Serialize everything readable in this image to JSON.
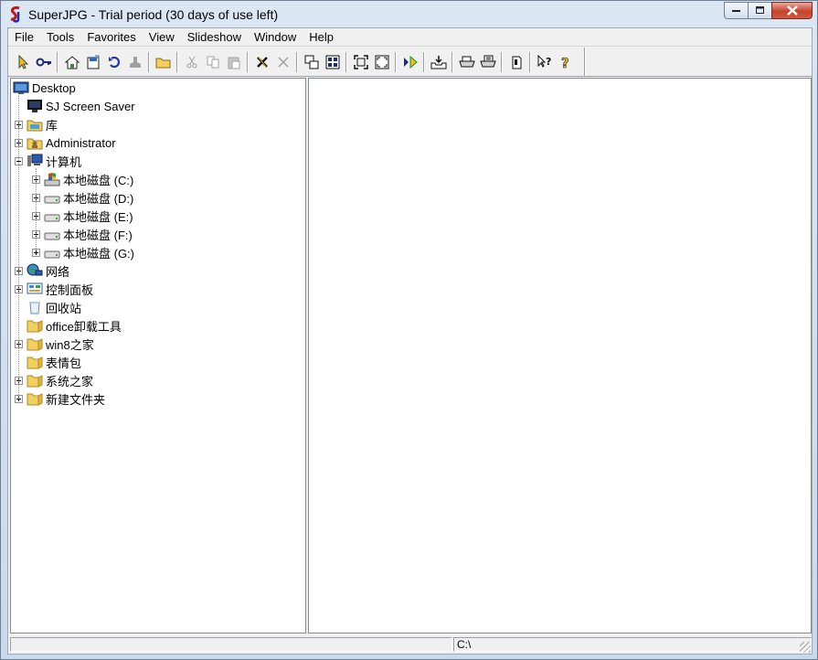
{
  "window": {
    "title": "SuperJPG - Trial period (30 days of use left)"
  },
  "menu": [
    "File",
    "Tools",
    "Favorites",
    "View",
    "Slideshow",
    "Window",
    "Help"
  ],
  "tree": {
    "root": "Desktop",
    "items": [
      {
        "label": "SJ Screen Saver",
        "level": 1,
        "expander": "none",
        "icon": "monitor-icon"
      },
      {
        "label": "库",
        "level": 1,
        "expander": "plus",
        "icon": "library-icon"
      },
      {
        "label": "Administrator",
        "level": 1,
        "expander": "plus",
        "icon": "user-folder-icon"
      },
      {
        "label": "计算机",
        "level": 1,
        "expander": "minus",
        "icon": "computer-icon"
      },
      {
        "label": "本地磁盘 (C:)",
        "level": 2,
        "expander": "plus",
        "icon": "system-drive-icon"
      },
      {
        "label": "本地磁盘 (D:)",
        "level": 2,
        "expander": "plus",
        "icon": "drive-icon"
      },
      {
        "label": "本地磁盘 (E:)",
        "level": 2,
        "expander": "plus",
        "icon": "drive-icon"
      },
      {
        "label": "本地磁盘 (F:)",
        "level": 2,
        "expander": "plus",
        "icon": "drive-icon"
      },
      {
        "label": "本地磁盘 (G:)",
        "level": 2,
        "expander": "plus",
        "icon": "drive-icon"
      },
      {
        "label": "网络",
        "level": 1,
        "expander": "plus",
        "icon": "network-icon"
      },
      {
        "label": "控制面板",
        "level": 1,
        "expander": "plus",
        "icon": "control-panel-icon"
      },
      {
        "label": "回收站",
        "level": 1,
        "expander": "none",
        "icon": "recycle-bin-icon"
      },
      {
        "label": "office卸载工具",
        "level": 1,
        "expander": "none",
        "icon": "folder-icon"
      },
      {
        "label": "win8之家",
        "level": 1,
        "expander": "plus",
        "icon": "folder-icon"
      },
      {
        "label": "表情包",
        "level": 1,
        "expander": "none",
        "icon": "folder-icon"
      },
      {
        "label": "系统之家",
        "level": 1,
        "expander": "plus",
        "icon": "folder-icon"
      },
      {
        "label": "新建文件夹",
        "level": 1,
        "expander": "plus",
        "icon": "folder-icon"
      }
    ]
  },
  "status": {
    "path": "C:\\"
  },
  "colors": {
    "title_bg": "#dbe6f3",
    "close_red": "#c7432c",
    "selection_blue": "#3b6ea5"
  }
}
